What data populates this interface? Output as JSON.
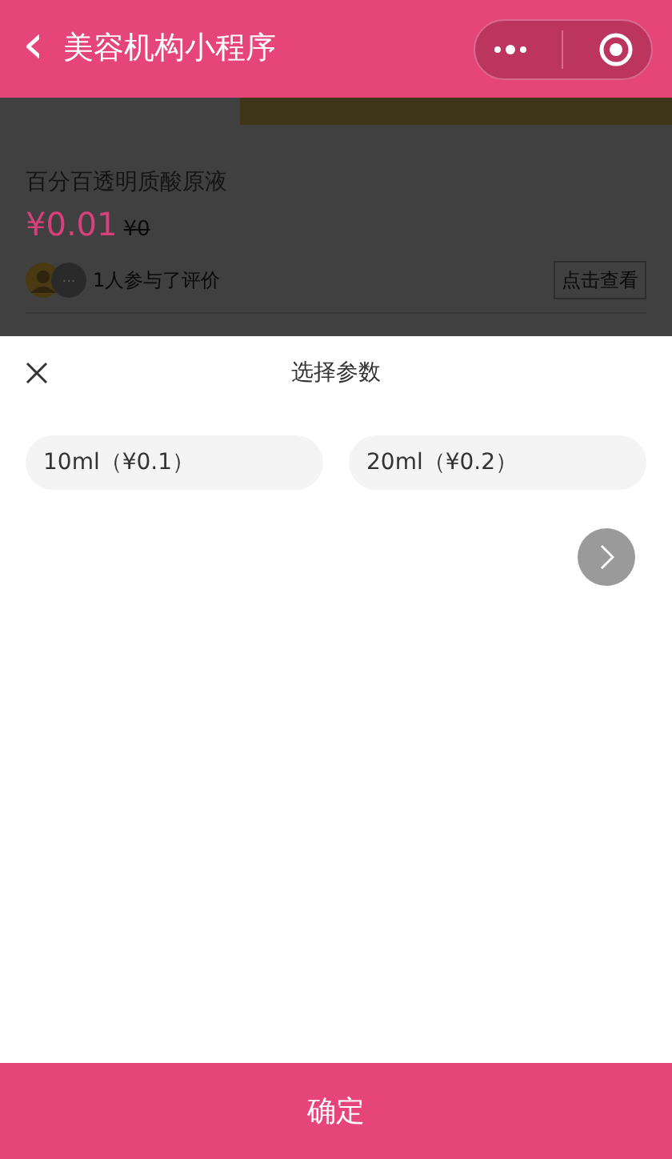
{
  "nav_bar": {
    "back_icon": "‹",
    "title": "美容机构小程序"
  },
  "product": {
    "title": "百分百透明质酸原液",
    "price": "¥0.01",
    "original_price": "¥0",
    "review_more": "...",
    "review_text": "1人参与了评价",
    "review_button": "点击查看"
  },
  "sheet": {
    "title": "选择参数",
    "options": [
      {
        "label": "10ml（¥0.1）",
        "selected": false
      },
      {
        "label": "20ml（¥0.2）",
        "selected": false
      }
    ],
    "confirm": "确定"
  }
}
